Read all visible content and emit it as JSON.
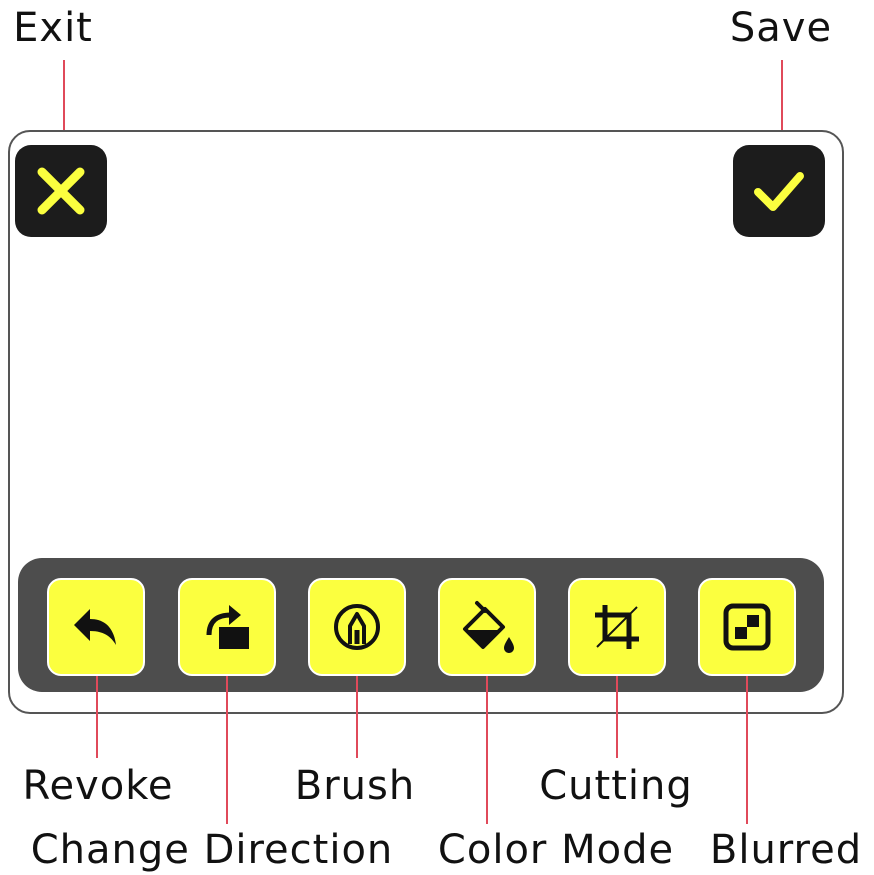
{
  "labels": {
    "exit": "Exit",
    "save": "Save",
    "revoke": "Revoke",
    "change_direction": "Change Direction",
    "brush": "Brush",
    "color_mode": "Color Mode",
    "cutting": "Cutting",
    "blurred": "Blurred"
  },
  "tools": [
    {
      "name": "revoke",
      "icon": "undo-icon"
    },
    {
      "name": "change-direction",
      "icon": "rotate-icon"
    },
    {
      "name": "brush",
      "icon": "pencil-icon"
    },
    {
      "name": "color-mode",
      "icon": "paint-bucket-icon"
    },
    {
      "name": "cutting",
      "icon": "crop-icon"
    },
    {
      "name": "blurred",
      "icon": "mosaic-icon"
    }
  ],
  "colors": {
    "accent": "#fbff3f",
    "dark": "#1c1c1c",
    "toolbar": "#4d4d4d",
    "leader_line": "#e04a5a"
  }
}
